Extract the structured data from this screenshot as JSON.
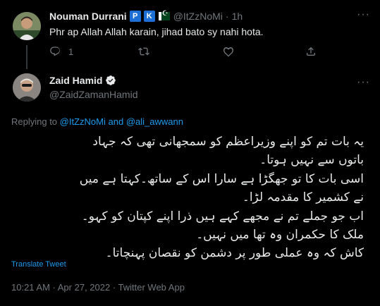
{
  "parent_tweet": {
    "display_name": "Nouman Durrani",
    "badges": [
      "P",
      "K"
    ],
    "handle": "@ItZzNoMi",
    "separator": "·",
    "time": "1h",
    "text": "Phr ap Allah Allah karain, jihad bato sy nahi hota.",
    "reply_count": "1",
    "icons": [
      "reply-icon",
      "retweet-icon",
      "like-icon",
      "share-icon"
    ]
  },
  "main_tweet": {
    "display_name": "Zaid Hamid",
    "handle": "@ZaidZamanHamid",
    "replying_prefix": "Replying to",
    "replying_to_1": "@ItZzNoMi",
    "replying_and": "and",
    "replying_to_2": "@ali_awwann",
    "lines": [
      "یہ بات تم کو اپنے وزیراعظم کو سمجھانی تھی کہ جہاد",
      "باتوں سے نہیں ہوتا۔",
      "اسی بات کا تو جھگڑا ہے سارا اس کے ساتھ۔کہتا ہے میں",
      "نے کشمیر کا مقدمہ لڑا۔",
      "اب جو جملے تم نے مجھے کہے ہیں ذرا اپنے کپتان کو کہو۔",
      "ملک کا حکمران وہ تھا میں نہیں۔",
      "کاش کہ وہ عملی طور پر دشمن کو نقصان پہنچاتا۔"
    ],
    "translate_label": "Translate Tweet",
    "timestamp": "10:21 AM · Apr 27, 2022 · Twitter Web App"
  },
  "colors": {
    "background": "#000000",
    "text": "#e7e9ea",
    "secondary": "#71767b",
    "accent": "#1d9bf0"
  }
}
